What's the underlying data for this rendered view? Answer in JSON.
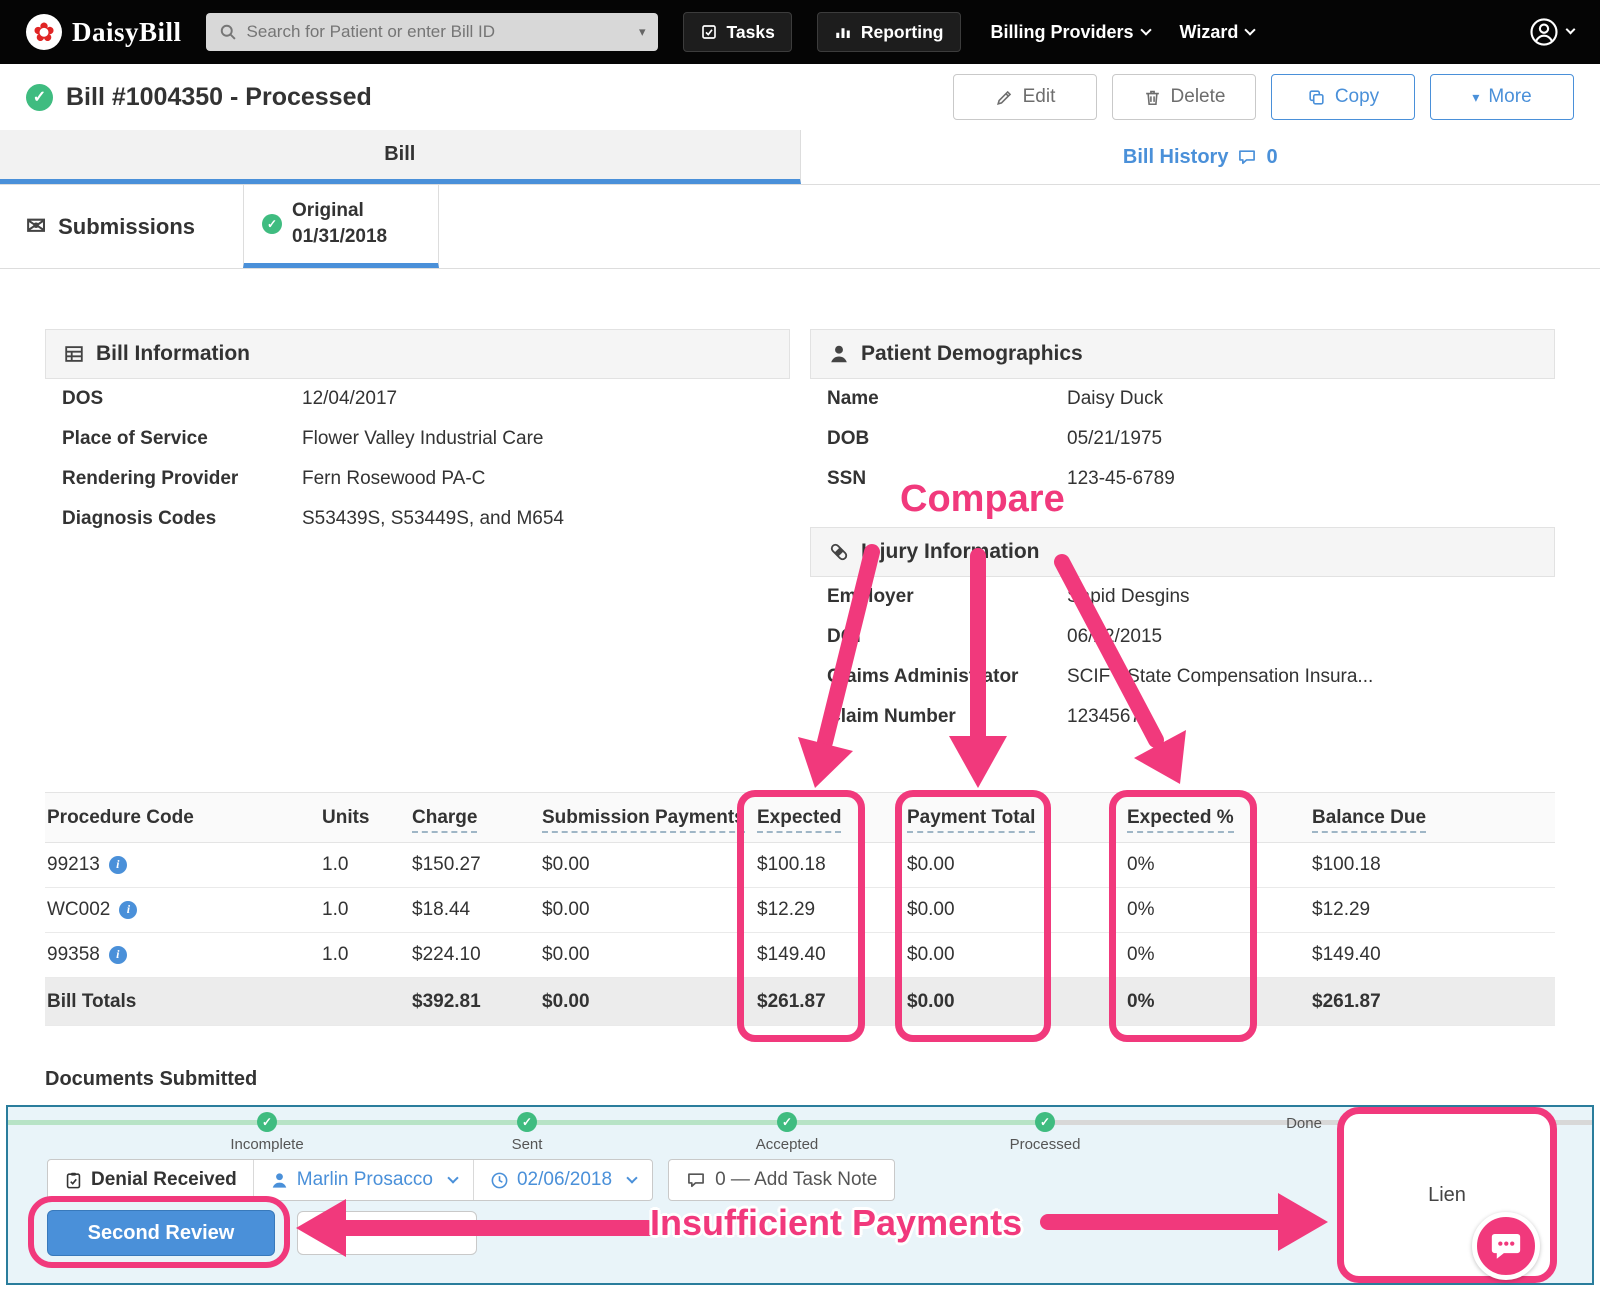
{
  "navbar": {
    "brand": "DaisyBill",
    "search_placeholder": "Search for Patient or enter Bill ID",
    "tasks": "Tasks",
    "reporting": "Reporting",
    "billing_providers": "Billing Providers",
    "wizard": "Wizard"
  },
  "header": {
    "title": "Bill #1004350 - Processed",
    "edit": "Edit",
    "delete": "Delete",
    "copy": "Copy",
    "more": "More"
  },
  "tabs": {
    "bill": "Bill",
    "bill_history": "Bill History",
    "bill_history_count": "0"
  },
  "subtabs": {
    "submissions": "Submissions",
    "original": "Original",
    "original_date": "01/31/2018"
  },
  "panels": {
    "bill_info": {
      "title": "Bill Information",
      "rows": [
        {
          "label": "DOS",
          "value": "12/04/2017"
        },
        {
          "label": "Place of Service",
          "value": "Flower Valley Industrial Care"
        },
        {
          "label": "Rendering Provider",
          "value": "Fern Rosewood PA-C"
        },
        {
          "label": "Diagnosis Codes",
          "value": "S53439S, S53449S, and M654"
        }
      ]
    },
    "patient": {
      "title": "Patient Demographics",
      "rows": [
        {
          "label": "Name",
          "value": "Daisy Duck"
        },
        {
          "label": "DOB",
          "value": "05/21/1975"
        },
        {
          "label": "SSN",
          "value": "123-45-6789"
        }
      ]
    },
    "injury": {
      "title": "Injury Information",
      "rows": [
        {
          "label": "Employer",
          "value": "Sapid Desgins"
        },
        {
          "label": "DOI",
          "value": "06/22/2015"
        },
        {
          "label": "Claims Administrator",
          "value": "SCIF - State Compensation Insura..."
        },
        {
          "label": "Claim Number",
          "value": "1234567"
        }
      ]
    }
  },
  "table": {
    "headers": [
      "Procedure Code",
      "Units",
      "Charge",
      "Submission Payments",
      "Expected",
      "Payment Total",
      "Expected %",
      "Balance Due"
    ],
    "rows": [
      [
        "99213",
        "1.0",
        "$150.27",
        "$0.00",
        "$100.18",
        "$0.00",
        "0%",
        "$100.18"
      ],
      [
        "WC002",
        "1.0",
        "$18.44",
        "$0.00",
        "$12.29",
        "$0.00",
        "0%",
        "$12.29"
      ],
      [
        "99358",
        "1.0",
        "$224.10",
        "$0.00",
        "$149.40",
        "$0.00",
        "0%",
        "$149.40"
      ]
    ],
    "totals": [
      "Bill Totals",
      "",
      "$392.81",
      "$0.00",
      "$261.87",
      "$0.00",
      "0%",
      "$261.87"
    ]
  },
  "documents": {
    "title": "Documents Submitted"
  },
  "workflow": {
    "steps": [
      {
        "label": "Incomplete",
        "state": "complete"
      },
      {
        "label": "Sent",
        "state": "complete"
      },
      {
        "label": "Accepted",
        "state": "complete"
      },
      {
        "label": "Processed",
        "state": "complete"
      },
      {
        "label": "Done",
        "state": "pending"
      }
    ],
    "task_title": "Denial Received",
    "assignee": "Marlin Prosacco",
    "date": "02/06/2018",
    "note": "0 — Add Task Note",
    "second_review": "Second Review",
    "lien": "Lien"
  },
  "annotations": {
    "compare": "Compare",
    "insufficient_payments": "Insufficient Payments",
    "highlight_color": "#f1397c"
  }
}
